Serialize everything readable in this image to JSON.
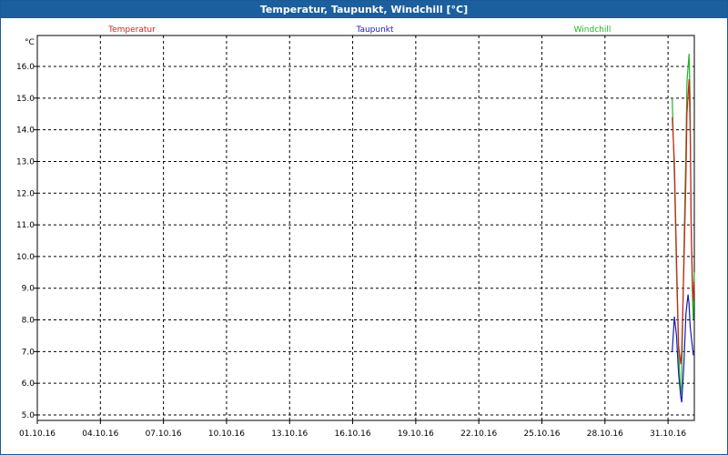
{
  "window": {
    "title": "Temperatur, Taupunkt, Windchill [°C]"
  },
  "chart_data": {
    "type": "line",
    "title": "Temperatur, Taupunkt, Windchill [°C]",
    "ylabel": "°C",
    "ylim": [
      5.0,
      16.0
    ],
    "y_ticks": [
      "5.0",
      "6.0",
      "7.0",
      "8.0",
      "9.0",
      "10.0",
      "11.0",
      "12.0",
      "13.0",
      "14.0",
      "15.0",
      "16.0"
    ],
    "x_ticks": [
      "01.10.16",
      "04.10.16",
      "07.10.16",
      "10.10.16",
      "13.10.16",
      "16.10.16",
      "19.10.16",
      "22.10.16",
      "25.10.16",
      "28.10.16",
      "31.10.16"
    ],
    "xlim_days": [
      0,
      31.25
    ],
    "grid": true,
    "legend_placement": "top",
    "series": [
      {
        "name": "Temperatur",
        "color": "#d42020",
        "x": [
          30.2,
          30.3,
          30.4,
          30.5,
          30.6,
          30.65,
          30.75,
          30.85,
          30.9,
          31.0,
          31.05,
          31.1,
          31.15,
          31.2,
          31.25
        ],
        "y": [
          14.4,
          13.0,
          10.0,
          7.2,
          6.6,
          7.0,
          9.5,
          12.5,
          14.5,
          15.6,
          14.0,
          11.0,
          9.5,
          8.6,
          9.2
        ]
      },
      {
        "name": "Taupunkt",
        "color": "#1a1ab4",
        "x": [
          30.2,
          30.3,
          30.4,
          30.5,
          30.6,
          30.65,
          30.75,
          30.85,
          30.95,
          31.0,
          31.05,
          31.1,
          31.15,
          31.2,
          31.25
        ],
        "y": [
          7.0,
          8.1,
          7.5,
          6.3,
          5.6,
          5.4,
          6.5,
          8.2,
          8.8,
          8.5,
          7.8,
          7.5,
          7.2,
          6.9,
          6.9
        ]
      },
      {
        "name": "Windchill",
        "color": "#22b422",
        "x": [
          30.2,
          30.3,
          30.4,
          30.5,
          30.6,
          30.65,
          30.75,
          30.85,
          30.9,
          31.0,
          31.05,
          31.1,
          31.15,
          31.2,
          31.25
        ],
        "y": [
          15.0,
          12.5,
          9.5,
          7.0,
          5.6,
          6.0,
          10.0,
          13.5,
          15.5,
          16.4,
          15.0,
          11.0,
          9.0,
          8.0,
          9.5
        ]
      }
    ]
  }
}
